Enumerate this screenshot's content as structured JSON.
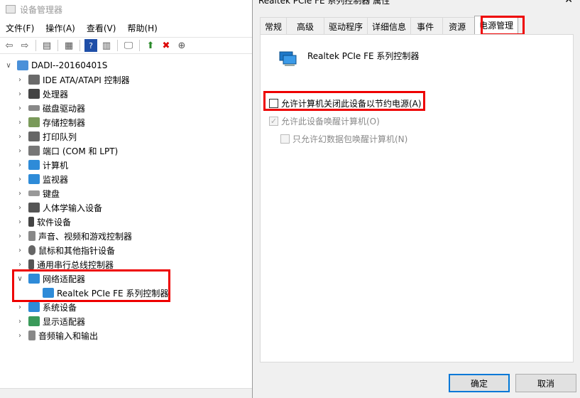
{
  "devmgr": {
    "title": "设备管理器",
    "menu": [
      "文件(F)",
      "操作(A)",
      "查看(V)",
      "帮助(H)"
    ],
    "root": "DADI--20160401S",
    "items": [
      "IDE ATA/ATAPI 控制器",
      "处理器",
      "磁盘驱动器",
      "存储控制器",
      "打印队列",
      "端口 (COM 和 LPT)",
      "计算机",
      "监视器",
      "键盘",
      "人体学输入设备",
      "软件设备",
      "声音、视频和游戏控制器",
      "鼠标和其他指针设备",
      "通用串行总线控制器",
      "网络适配器",
      "Realtek PCIe FE 系列控制器",
      "系统设备",
      "显示适配器",
      "音频输入和输出"
    ]
  },
  "dialog": {
    "title": "Realtek PCIe FE 系列控制器 属性",
    "close": "✕",
    "tabs": [
      "常规",
      "高级",
      "驱动程序",
      "详细信息",
      "事件",
      "资源",
      "电源管理"
    ],
    "device_name": "Realtek PCIe FE 系列控制器",
    "options": [
      "允许计算机关闭此设备以节约电源(A)",
      "允许此设备唤醒计算机(O)",
      "只允许幻数据包唤醒计算机(N)"
    ],
    "ok": "确定",
    "cancel": "取消"
  },
  "colors": {
    "highlight": "#e00000",
    "accent": "#0078d7"
  }
}
